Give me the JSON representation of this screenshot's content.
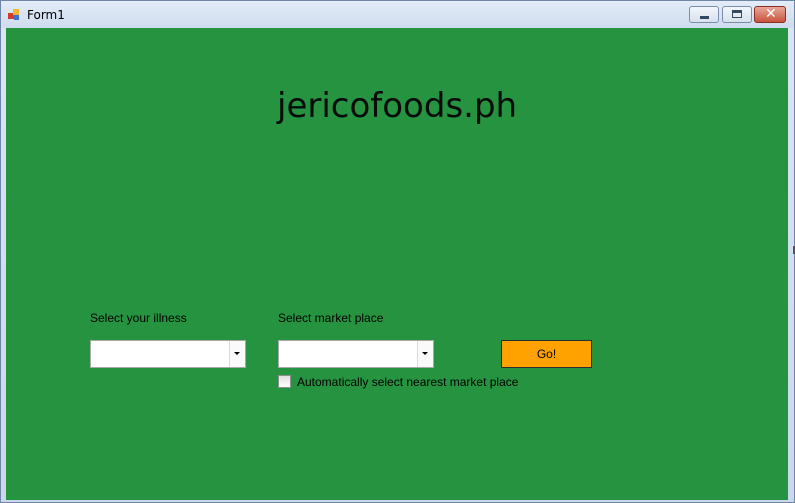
{
  "window": {
    "title": "Form1",
    "icon": "winforms-app-icon",
    "controls": {
      "minimize": "minimize-icon",
      "maximize": "maximize-icon",
      "close_glyph": "✕"
    }
  },
  "form": {
    "heading": "jericofoods.ph",
    "illness": {
      "label": "Select your illness",
      "value": ""
    },
    "market": {
      "label": "Select market place",
      "value": ""
    },
    "go_button_label": "Go!",
    "auto_select_label": "Automatically select nearest market place",
    "auto_select_checked": false
  },
  "colors": {
    "form_background": "#259340",
    "go_button": "#ffa200"
  }
}
